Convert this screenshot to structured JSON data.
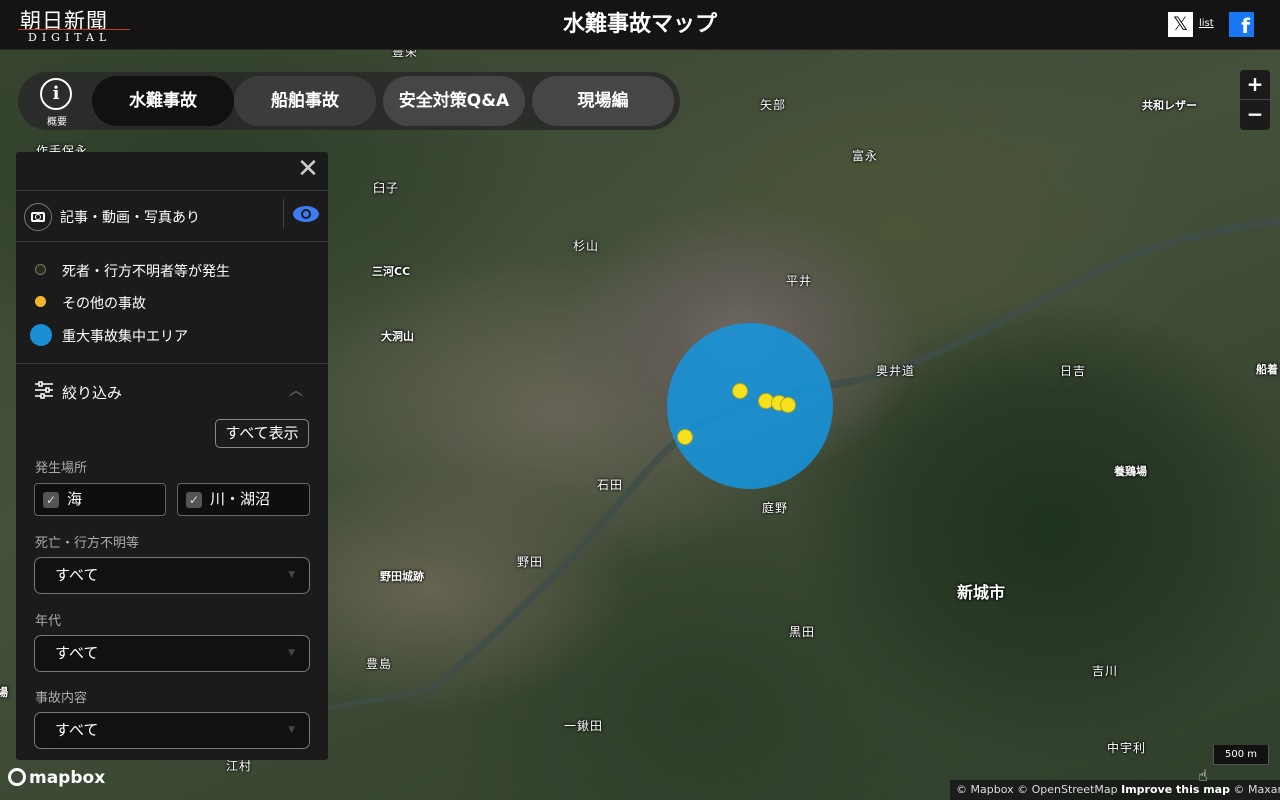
{
  "header": {
    "logo_top": "朝日新聞",
    "logo_bottom": "DIGITAL",
    "title": "水難事故マップ",
    "x_icon": "x-icon",
    "x_list": "list",
    "fb_icon": "facebook-icon",
    "fb_glyph": "f"
  },
  "nav": {
    "info_label": "概要",
    "tabs": [
      {
        "label": "水難事故",
        "active": true
      },
      {
        "label": "船舶事故",
        "active": false
      },
      {
        "label": "安全対策Q&A",
        "active": false
      },
      {
        "label": "現場編",
        "active": false
      }
    ]
  },
  "panel": {
    "close_glyph": "✕",
    "media_toggle": "記事・動画・写真あり",
    "legend": [
      {
        "label": "死者・行方不明者等が発生",
        "color": "#2b2b1e"
      },
      {
        "label": "その他の事故",
        "color": "#f5b52a"
      },
      {
        "label": "重大事故集中エリア",
        "color": "#1a8fd6"
      }
    ],
    "filter_title": "絞り込み",
    "show_all": "すべて表示",
    "location_label": "発生場所",
    "location_options": [
      "海",
      "川・湖沼"
    ],
    "death_label": "死亡・行方不明等",
    "death_value": "すべて",
    "era_label": "年代",
    "era_value": "すべて",
    "type_label": "事故内容",
    "type_value": "すべて"
  },
  "map": {
    "labels": [
      "豊栄",
      "矢部",
      "共和レザー",
      "作手保永",
      "富永",
      "臼子",
      "杉山",
      "三河CC",
      "平井",
      "大洞山",
      "奥井道",
      "日吉",
      "船着",
      "石田",
      "庭野",
      "養鶏場",
      "野田",
      "野田城跡",
      "新城市",
      "黒田",
      "豊島",
      "吉川",
      "一鍬田",
      "中宇利",
      "江村",
      "城場"
    ],
    "zoom_in": "+",
    "zoom_out": "−",
    "scale": "500 m",
    "mapbox": "mapbox",
    "attrib_1": "© Mapbox © OpenStreetMap",
    "attrib_2": "Improve this map",
    "attrib_3": "© Maxar"
  }
}
